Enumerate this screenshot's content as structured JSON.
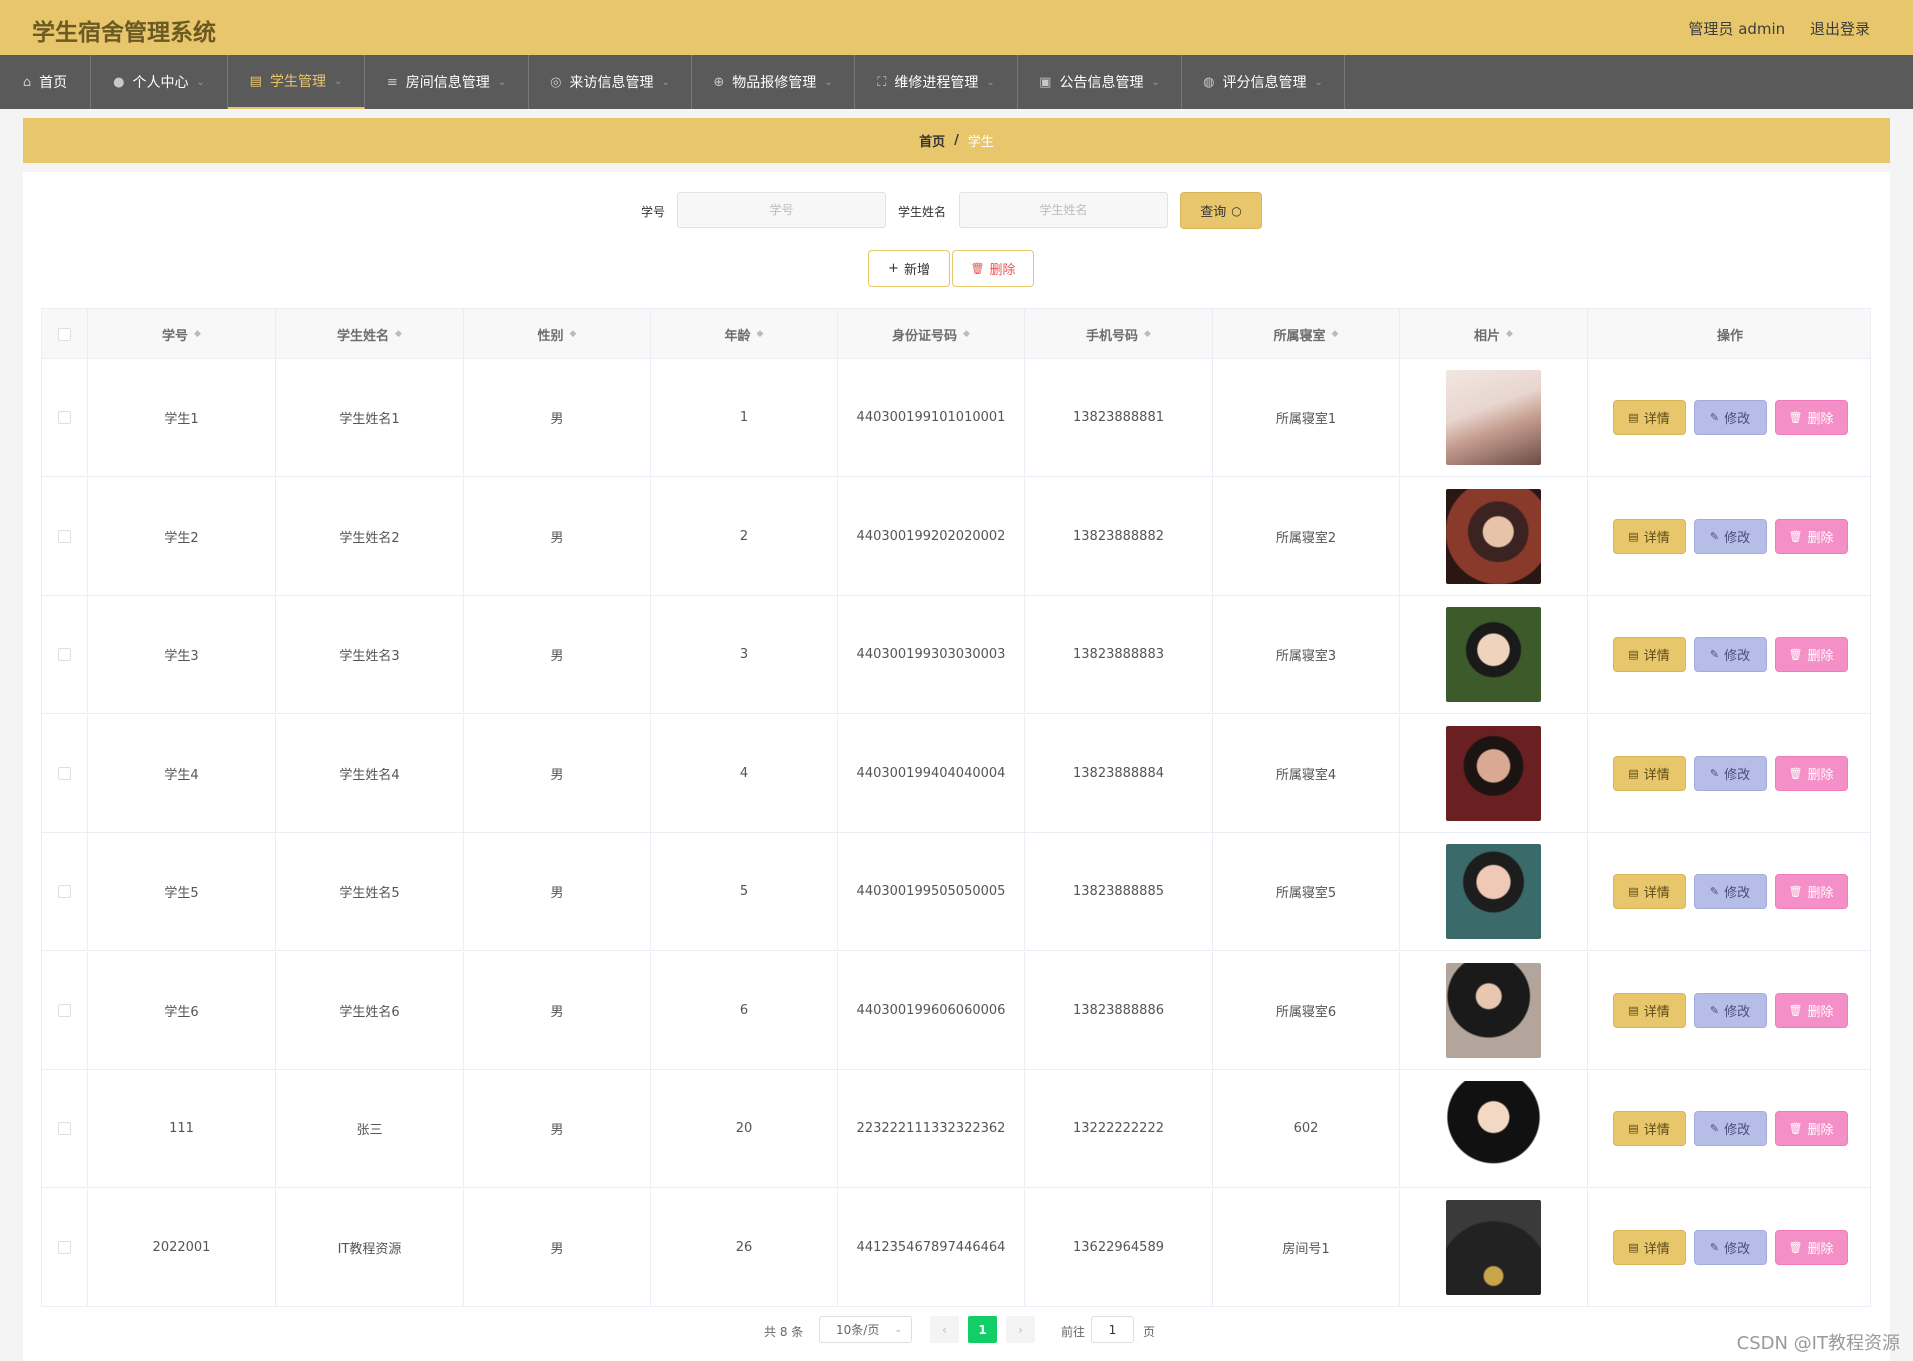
{
  "app": {
    "title": "学生宿舍管理系统"
  },
  "header": {
    "user": "管理员 admin",
    "logout": "退出登录"
  },
  "nav": {
    "items": [
      {
        "label": "首页",
        "icon": "home-icon"
      },
      {
        "label": "个人中心",
        "icon": "user-icon"
      },
      {
        "label": "学生管理",
        "icon": "chart-icon",
        "active": true
      },
      {
        "label": "房间信息管理",
        "icon": "list-icon"
      },
      {
        "label": "来访信息管理",
        "icon": "compass-icon"
      },
      {
        "label": "物品报修管理",
        "icon": "globe-icon"
      },
      {
        "label": "维修进程管理",
        "icon": "fullscreen-icon"
      },
      {
        "label": "公告信息管理",
        "icon": "clipboard-icon"
      },
      {
        "label": "评分信息管理",
        "icon": "basketball-icon"
      }
    ]
  },
  "breadcrumb": {
    "home": "首页",
    "separator": "/",
    "current": "学生"
  },
  "search": {
    "student_no_label": "学号",
    "student_no_placeholder": "学号",
    "student_name_label": "学生姓名",
    "student_name_placeholder": "学生姓名",
    "query_button": "查询"
  },
  "actions": {
    "add": "新增",
    "delete": "删除"
  },
  "table": {
    "columns": [
      "学号",
      "学生姓名",
      "性别",
      "年龄",
      "身份证号码",
      "手机号码",
      "所属寝室",
      "相片",
      "操作"
    ],
    "row_actions": {
      "detail": "详情",
      "edit": "修改",
      "remove": "删除"
    },
    "rows": [
      {
        "no": "学生1",
        "name": "学生姓名1",
        "gender": "男",
        "age": "1",
        "id_card": "440300199101010001",
        "phone": "13823888881",
        "room": "所属寝室1"
      },
      {
        "no": "学生2",
        "name": "学生姓名2",
        "gender": "男",
        "age": "2",
        "id_card": "440300199202020002",
        "phone": "13823888882",
        "room": "所属寝室2"
      },
      {
        "no": "学生3",
        "name": "学生姓名3",
        "gender": "男",
        "age": "3",
        "id_card": "440300199303030003",
        "phone": "13823888883",
        "room": "所属寝室3"
      },
      {
        "no": "学生4",
        "name": "学生姓名4",
        "gender": "男",
        "age": "4",
        "id_card": "440300199404040004",
        "phone": "13823888884",
        "room": "所属寝室4"
      },
      {
        "no": "学生5",
        "name": "学生姓名5",
        "gender": "男",
        "age": "5",
        "id_card": "440300199505050005",
        "phone": "13823888885",
        "room": "所属寝室5"
      },
      {
        "no": "学生6",
        "name": "学生姓名6",
        "gender": "男",
        "age": "6",
        "id_card": "440300199606060006",
        "phone": "13823888886",
        "room": "所属寝室6"
      },
      {
        "no": "111",
        "name": "张三",
        "gender": "男",
        "age": "20",
        "id_card": "223222111332322362",
        "phone": "13222222222",
        "room": "602"
      },
      {
        "no": "2022001",
        "name": "IT教程资源",
        "gender": "男",
        "age": "26",
        "id_card": "441235467897446464",
        "phone": "13622964589",
        "room": "房间号1"
      }
    ]
  },
  "pagination": {
    "total_text": "共 8 条",
    "page_size": "10条/页",
    "current_page": "1",
    "goto_label": "前往",
    "goto_value": "1",
    "goto_unit": "页"
  },
  "watermark": "CSDN @IT教程资源",
  "colors": {
    "primary": "#e8c66c",
    "nav_bg": "#5a5a5a",
    "edit": "#b6bde6",
    "remove": "#f58fc8",
    "page_active": "#13ce66"
  }
}
